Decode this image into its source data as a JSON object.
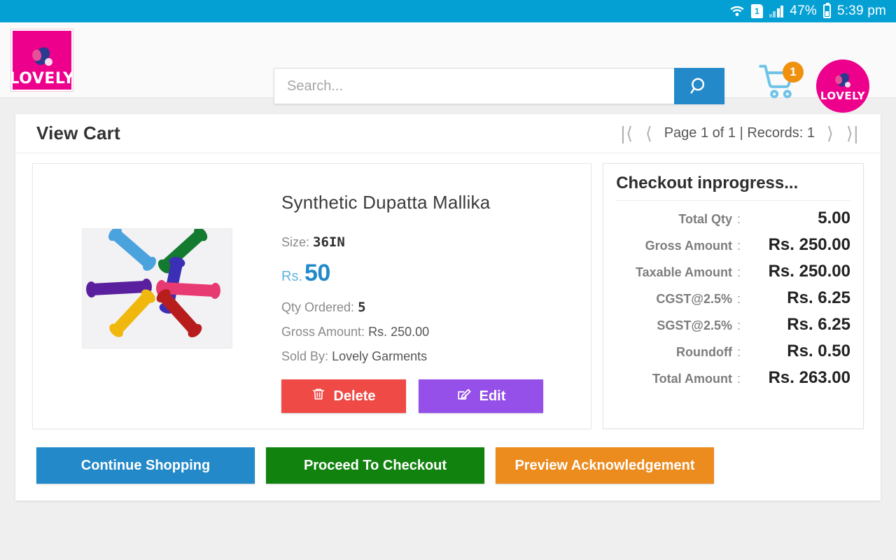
{
  "statusbar": {
    "wifi_icon": "wifi-icon",
    "sim_label": "1",
    "signal_icon": "signal-bars-icon",
    "battery_percent": "47%",
    "battery_icon": "battery-icon",
    "time": "5:39 pm"
  },
  "header": {
    "logo_text": "LOVELY",
    "search": {
      "placeholder": "Search...",
      "value": "",
      "button_icon": "search-icon"
    },
    "cart": {
      "icon": "shopping-cart-icon",
      "badge_count": "1"
    },
    "avatar": {
      "icon": "user-avatar-icon",
      "text": "LOVELY"
    }
  },
  "page": {
    "title": "View Cart",
    "pagination": {
      "first_icon": "first-page-icon",
      "prev_icon": "previous-page-icon",
      "text": "Page 1 of 1 | Records: 1",
      "next_icon": "next-page-icon",
      "last_icon": "last-page-icon"
    }
  },
  "product": {
    "image_alt": "colorful-bones-product-image",
    "name": "Synthetic Dupatta Mallika",
    "size_label": "Size:",
    "size_value": "36IN",
    "price_currency": "Rs.",
    "price_value": "50",
    "qty_label": "Qty Ordered:",
    "qty_value": "5",
    "gross_label": "Gross Amount:",
    "gross_value": "Rs. 250.00",
    "sold_by_label": "Sold By:",
    "sold_by_value": "Lovely Garments",
    "delete_label": "Delete",
    "delete_icon": "trash-icon",
    "edit_label": "Edit",
    "edit_icon": "edit-pencil-icon"
  },
  "summary": {
    "title": "Checkout inprogress...",
    "rows": [
      {
        "label": "Total Qty",
        "value": "5.00"
      },
      {
        "label": "Gross Amount",
        "value": "Rs. 250.00"
      },
      {
        "label": "Taxable Amount",
        "value": "Rs. 250.00"
      },
      {
        "label": "CGST@2.5%",
        "value": "Rs. 6.25"
      },
      {
        "label": "SGST@2.5%",
        "value": "Rs. 6.25"
      },
      {
        "label": "Roundoff",
        "value": "Rs. 0.50"
      },
      {
        "label": "Total Amount",
        "value": "Rs. 263.00"
      }
    ],
    "colon": ":"
  },
  "actions": {
    "continue_shopping": "Continue Shopping",
    "proceed_to_checkout": "Proceed To Checkout",
    "preview_acknowledgement": "Preview Acknowledgement"
  },
  "colors": {
    "status_bar": "#04a0d4",
    "brand_pink": "#ec008c",
    "accent_blue": "#2389c9",
    "delete_red": "#ef4a45",
    "edit_purple": "#9450e8",
    "checkout_green": "#12820f",
    "preview_orange": "#ec8b1e",
    "badge_orange": "#f0910e"
  }
}
